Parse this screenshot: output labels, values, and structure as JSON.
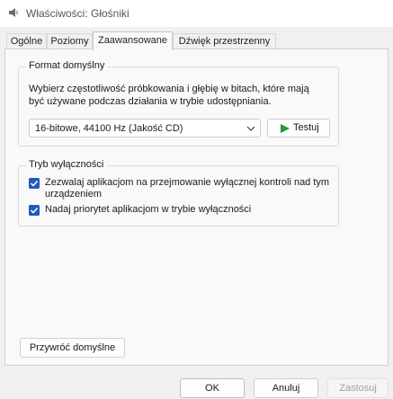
{
  "window": {
    "title": "Właściwości: Głośniki",
    "icon": "speaker-icon"
  },
  "tabs": [
    {
      "label": "Ogólne",
      "active": false
    },
    {
      "label": "Poziomy",
      "active": false
    },
    {
      "label": "Zaawansowane",
      "active": true
    },
    {
      "label": "Dźwięk przestrzenny",
      "active": false
    }
  ],
  "default_format": {
    "group_title": "Format domyślny",
    "description": "Wybierz częstotliwość próbkowania i głębię w bitach, które mają być używane podczas działania w trybie udostępniania.",
    "selected_format": "16-bitowe, 44100 Hz (Jakość CD)",
    "test_button": "Testuj",
    "test_icon": "play-icon"
  },
  "exclusive_mode": {
    "group_title": "Tryb wyłączności",
    "options": [
      {
        "label": "Zezwalaj aplikacjom na przejmowanie wyłącznej kontroli nad tym urządzeniem",
        "checked": true
      },
      {
        "label": "Nadaj priorytet aplikacjom w trybie wyłączności",
        "checked": true
      }
    ]
  },
  "restore_defaults_button": "Przywróć domyślne",
  "footer": {
    "ok": "OK",
    "cancel": "Anuluj",
    "apply": "Zastosuj",
    "apply_enabled": false
  },
  "colors": {
    "accent": "#1f5bbd",
    "play_green": "#1e9c3a"
  }
}
